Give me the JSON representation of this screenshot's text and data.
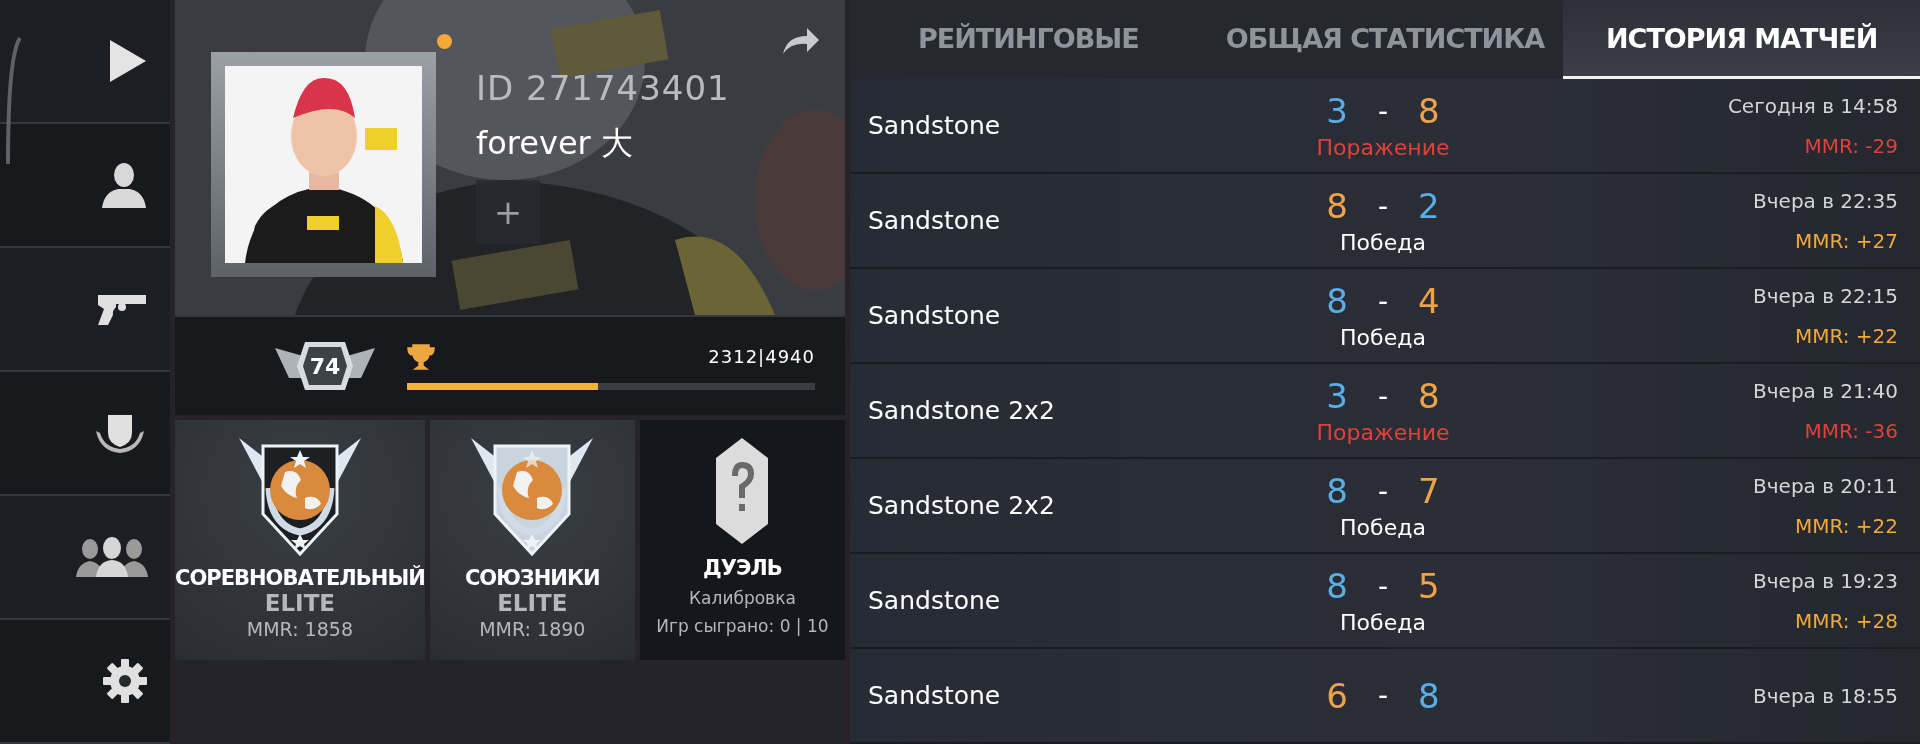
{
  "profile": {
    "online": true,
    "id": "ID 271743401",
    "name": "forever 大",
    "add_label": "+",
    "level": "74",
    "xp": {
      "text": "2312|4940",
      "level": 0.468
    }
  },
  "ranks": [
    {
      "kind": "rank",
      "title": "СОРЕВНОВАТЕЛЬНЫЙ",
      "rank": "ELITE",
      "mmr": "MMR: 1858"
    },
    {
      "kind": "rank",
      "title": "СОЮЗНИКИ",
      "rank": "ELITE",
      "mmr": "MMR: 1890"
    },
    {
      "kind": "calibration",
      "title": "ДУЭЛЬ",
      "status": "Калибровка",
      "games": "Игр сыграно: 0 | 10"
    }
  ],
  "tabs": [
    {
      "label": "РЕЙТИНГОВЫЕ",
      "selected": false
    },
    {
      "label": "ОБЩАЯ СТАТИСТИКА",
      "selected": false
    },
    {
      "label": "ИСТОРИЯ МАТЧЕЙ",
      "selected": true
    }
  ],
  "matches": [
    {
      "map": "Sandstone",
      "scores": [
        {
          "value": "3",
          "color": "#5aaee6"
        },
        {
          "value": "8",
          "color": "#eea24a"
        }
      ],
      "separator": "-",
      "kind": "loss",
      "result": "Поражение",
      "time": "Сегодня в 14:58",
      "mmr": "MMR: -29"
    },
    {
      "map": "Sandstone",
      "scores": [
        {
          "value": "8",
          "color": "#eea24a"
        },
        {
          "value": "2",
          "color": "#5aaee6"
        }
      ],
      "separator": "-",
      "kind": "win",
      "result": "Победа",
      "time": "Вчера в 22:35",
      "mmr": "MMR: +27"
    },
    {
      "map": "Sandstone",
      "scores": [
        {
          "value": "8",
          "color": "#5aaee6"
        },
        {
          "value": "4",
          "color": "#eea24a"
        }
      ],
      "separator": "-",
      "kind": "win",
      "result": "Победа",
      "time": "Вчера в 22:15",
      "mmr": "MMR: +22"
    },
    {
      "map": "Sandstone 2x2",
      "scores": [
        {
          "value": "3",
          "color": "#5aaee6"
        },
        {
          "value": "8",
          "color": "#eea24a"
        }
      ],
      "separator": "-",
      "kind": "loss",
      "result": "Поражение",
      "time": "Вчера в 21:40",
      "mmr": "MMR: -36"
    },
    {
      "map": "Sandstone 2x2",
      "scores": [
        {
          "value": "8",
          "color": "#5aaee6"
        },
        {
          "value": "7",
          "color": "#eea24a"
        }
      ],
      "separator": "-",
      "kind": "win",
      "result": "Победа",
      "time": "Вчера в 20:11",
      "mmr": "MMR: +22"
    },
    {
      "map": "Sandstone",
      "scores": [
        {
          "value": "8",
          "color": "#5aaee6"
        },
        {
          "value": "5",
          "color": "#eea24a"
        }
      ],
      "separator": "-",
      "kind": "win",
      "result": "Победа",
      "time": "Вчера в 19:23",
      "mmr": "MMR: +28"
    },
    {
      "map": "Sandstone",
      "scores": [
        {
          "value": "6",
          "color": "#eea24a"
        },
        {
          "value": "8",
          "color": "#5aaee6"
        }
      ],
      "separator": "-",
      "time": "Вчера в 18:55"
    }
  ]
}
